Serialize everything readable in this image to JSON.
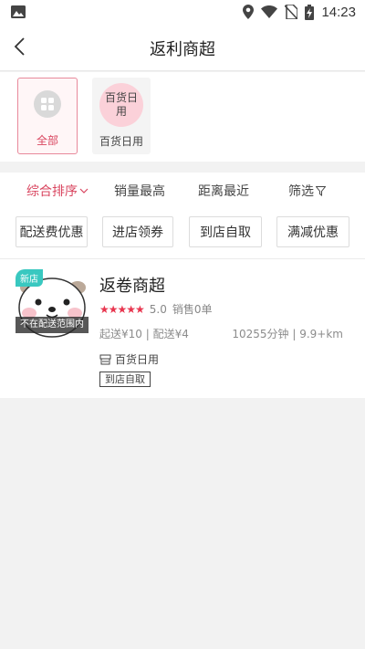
{
  "status_bar": {
    "time": "14:23",
    "icons": [
      "image-icon",
      "location-icon",
      "wifi-icon",
      "no-sim-icon",
      "battery-charging-icon"
    ]
  },
  "header": {
    "title": "返利商超",
    "back_icon": "chevron-left-icon"
  },
  "categories": [
    {
      "label": "全部",
      "icon": "grid-icon",
      "selected": true
    },
    {
      "label": "百货日用",
      "icon_text": "百货日用",
      "selected": false
    }
  ],
  "sort_bar": {
    "items": [
      {
        "label": "综合排序",
        "active": true,
        "icon": "chevron-down-icon"
      },
      {
        "label": "销量最高",
        "active": false
      },
      {
        "label": "距离最近",
        "active": false
      },
      {
        "label": "筛选",
        "active": false,
        "icon": "filter-icon"
      }
    ]
  },
  "filter_chips": [
    "配送费优惠",
    "进店领券",
    "到店自取",
    "满减优惠"
  ],
  "stores": [
    {
      "name": "返卷商超",
      "badge": "新店",
      "out_of_range": "不在配送范围内",
      "rating": "5.0",
      "stars": 5,
      "sales": "销售0单",
      "fees": "起送¥10 | 配送¥4",
      "time_distance": "10255分钟 | 9.9+km",
      "category": "百货日用",
      "category_icon": "store-icon",
      "tag": "到店自取"
    }
  ],
  "colors": {
    "accent": "#d9455f",
    "new_badge": "#39c8c0",
    "star": "#e8364f",
    "background": "#f2f2f2"
  }
}
